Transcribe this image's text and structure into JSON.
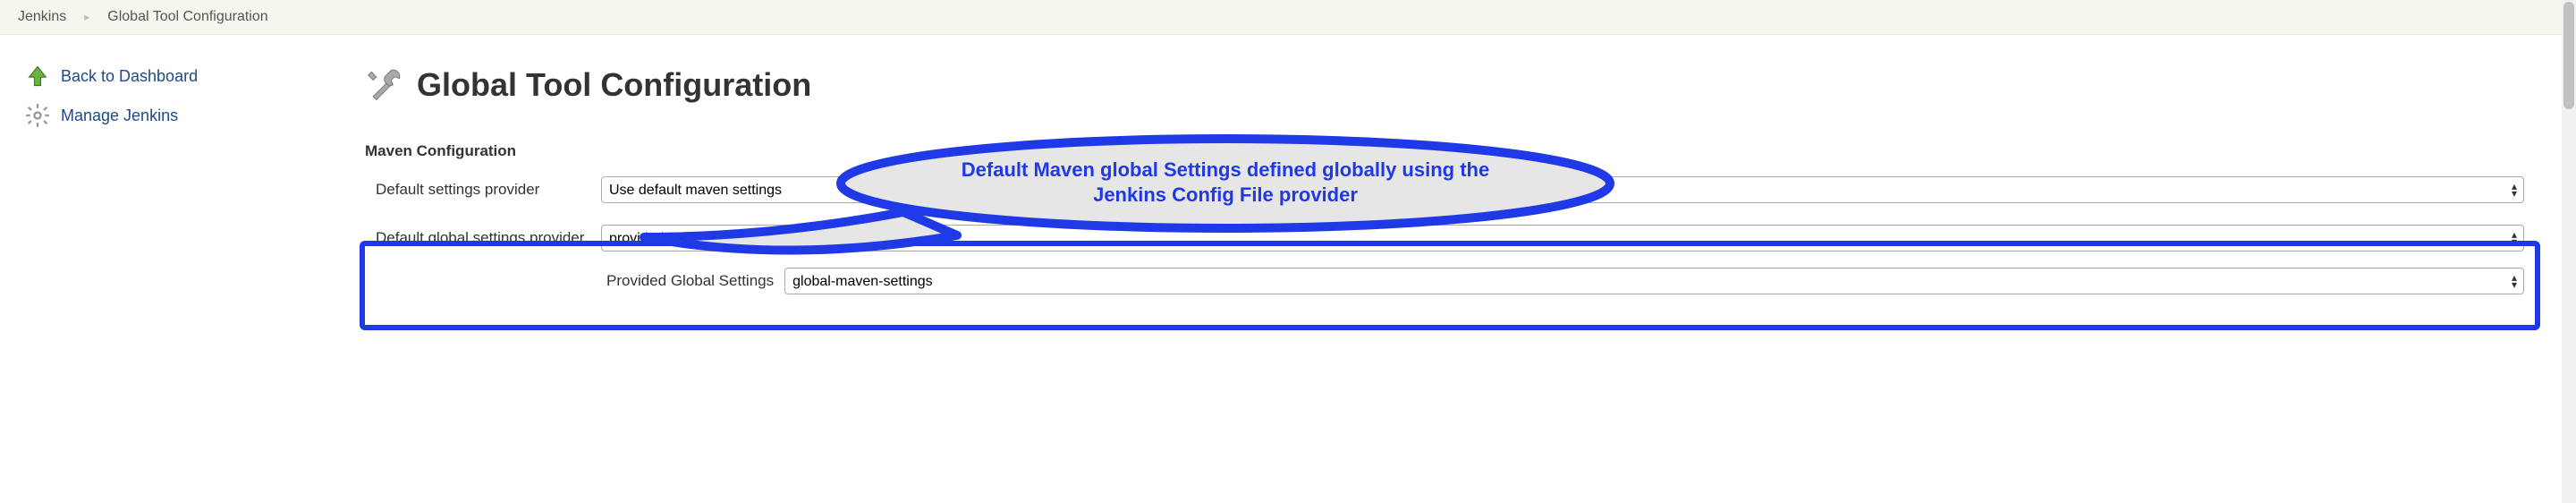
{
  "breadcrumb": {
    "root": "Jenkins",
    "current": "Global Tool Configuration"
  },
  "sidebar": {
    "back": "Back to Dashboard",
    "manage": "Manage Jenkins"
  },
  "page": {
    "title": "Global Tool Configuration"
  },
  "section": {
    "maven_config": "Maven Configuration"
  },
  "form": {
    "default_settings_label": "Default settings provider",
    "default_settings_value": "Use default maven settings",
    "global_settings_label": "Default global settings provider",
    "global_settings_value": "provided global settings.xml",
    "provided_global_label": "Provided Global Settings",
    "provided_global_value": "global-maven-settings"
  },
  "annotation": {
    "line1": "Default Maven global Settings defined globally using the",
    "line2": "Jenkins Config File provider"
  }
}
